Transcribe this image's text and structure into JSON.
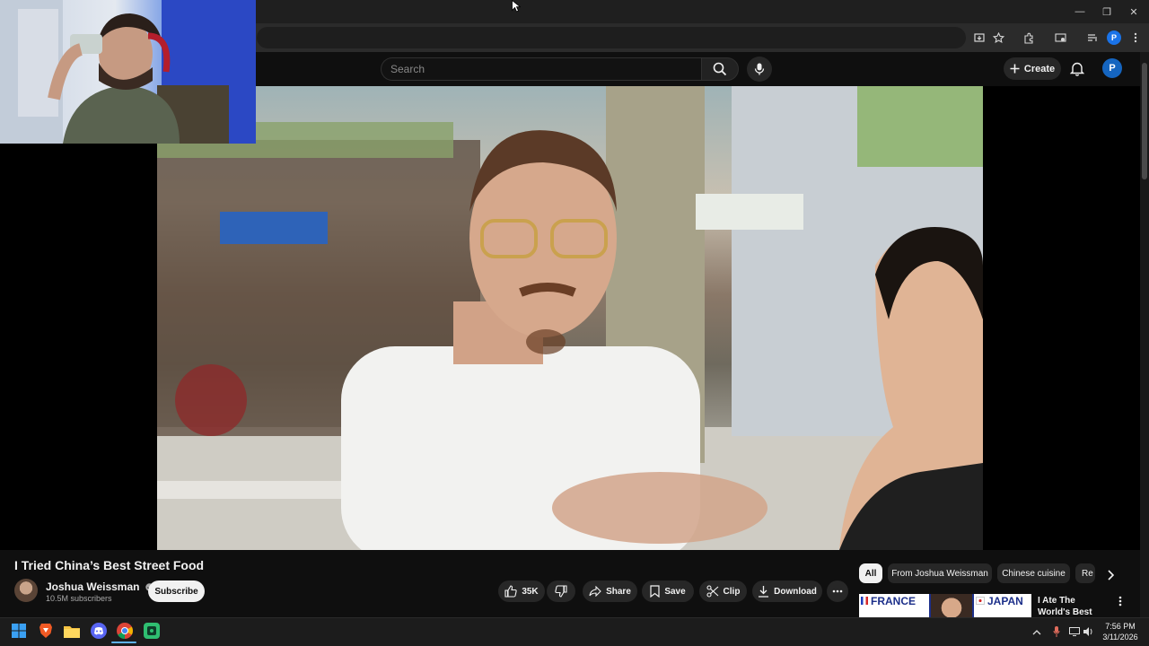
{
  "browser": {
    "window_controls": {
      "minimize": "—",
      "restore": "❐",
      "close": "✕"
    }
  },
  "masthead": {
    "search_placeholder": "Search",
    "create_label": "Create",
    "avatar_letter": "P"
  },
  "video": {
    "title": "I Tried China’s Best Street Food",
    "channel": "Joshua Weissman",
    "subscribers": "10.5M subscribers",
    "subscribe_label": "Subscribe",
    "likes": "35K",
    "share_label": "Share",
    "save_label": "Save",
    "clip_label": "Clip",
    "download_label": "Download"
  },
  "chips": {
    "items": [
      "All",
      "From Joshua Weissman",
      "Chinese cuisine",
      "Re"
    ]
  },
  "recommendation": {
    "thumb_left": "FRANCE",
    "thumb_right": "JAPAN",
    "title": "I Ate The World's Best Sandwich"
  },
  "taskbar": {
    "time": "7:56 PM",
    "date": "3/11/2026"
  },
  "colors": {
    "background": "#0f0f0f",
    "accent_blue": "#1565c0",
    "pill": "#272727"
  }
}
